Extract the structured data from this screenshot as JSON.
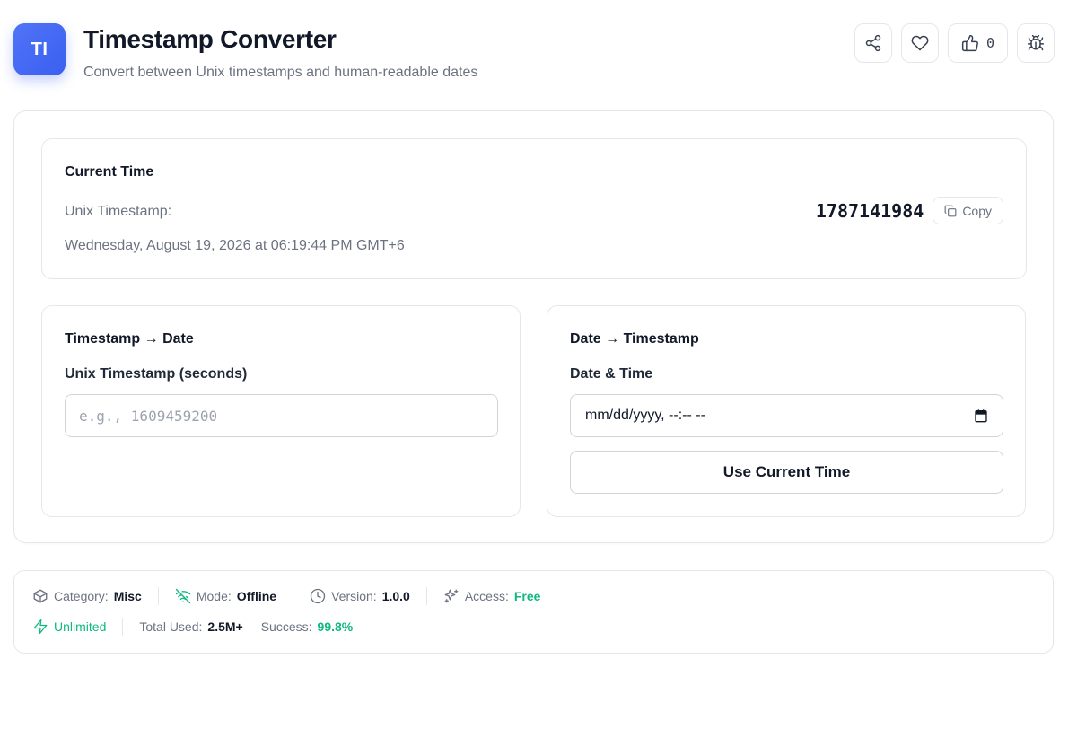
{
  "header": {
    "logo_text": "TI",
    "title": "Timestamp Converter",
    "subtitle": "Convert between Unix timestamps and human-readable dates",
    "like_count": "0"
  },
  "icons": {
    "share": "share-icon",
    "favorite": "heart-icon",
    "like": "thumbs-up-icon",
    "report": "bug-icon",
    "copy": "copy-icon",
    "calendar": "calendar-icon",
    "category": "box-icon",
    "mode": "wifi-off-icon",
    "version": "clock-icon",
    "access": "sparkles-icon",
    "limit": "zap-icon"
  },
  "current_time": {
    "title": "Current Time",
    "label": "Unix Timestamp:",
    "value": "1787141984",
    "copy_label": "Copy",
    "date_text": "Wednesday, August 19, 2026 at 06:19:44 PM GMT+6"
  },
  "ts_to_date": {
    "title": "Timestamp → Date",
    "input_label": "Unix Timestamp (seconds)",
    "input_placeholder": "e.g., 1609459200",
    "input_value": ""
  },
  "date_to_ts": {
    "title": "Date → Timestamp",
    "input_label": "Date & Time",
    "input_placeholder": "mm/dd/yyyy, --:-- --",
    "button_label": "Use Current Time"
  },
  "stats": {
    "category_label": "Category:",
    "category_value": "Misc",
    "mode_label": "Mode:",
    "mode_value": "Offline",
    "version_label": "Version:",
    "version_value": "1.0.0",
    "access_label": "Access:",
    "access_value": "Free",
    "limit_value": "Unlimited",
    "total_label": "Total Used:",
    "total_value": "2.5M+",
    "success_label": "Success:",
    "success_value": "99.8%"
  },
  "colors": {
    "brand": "#3b5ff0",
    "green": "#10b981",
    "border": "#e5e7eb",
    "muted_text": "#6b7280"
  }
}
